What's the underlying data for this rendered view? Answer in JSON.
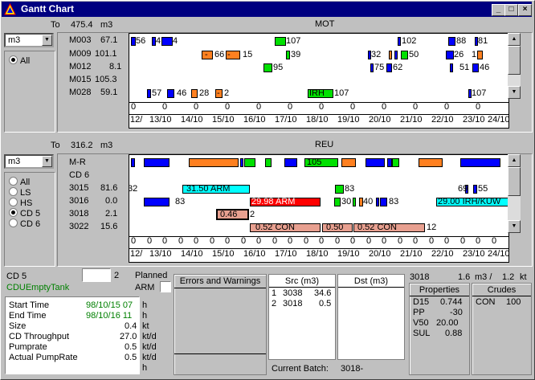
{
  "window": {
    "title": "Gantt Chart",
    "min": "_",
    "max": "□",
    "close": "×"
  },
  "mot": {
    "label_to": "To",
    "total": "475.4",
    "unit_label": "m3",
    "section_title": "MOT",
    "unit_select": "m3",
    "filter_all": "All",
    "rows": [
      {
        "name": "M003",
        "val": "67.1"
      },
      {
        "name": "M009",
        "val": "101.1"
      },
      {
        "name": "M012",
        "val": "8.1"
      },
      {
        "name": "M015",
        "val": "105.3"
      },
      {
        "name": "M028",
        "val": "59.1"
      }
    ],
    "bar_labels": [
      "56",
      "4",
      "4",
      "107",
      "102",
      "88",
      "81",
      "-",
      "66",
      "-",
      "15",
      "39",
      "32",
      "50",
      "26",
      "1",
      "95",
      "75",
      "62",
      "51",
      "46",
      "57",
      "46",
      "28",
      "-",
      "2",
      "IRH",
      "107"
    ],
    "axis_zero": "0",
    "dates": [
      "12/",
      "13/10",
      "14/10",
      "15/10",
      "16/10",
      "17/10",
      "18/10",
      "19/10",
      "20/10",
      "21/10",
      "22/10",
      "23/10",
      "24/10"
    ]
  },
  "reu": {
    "label_to": "To",
    "total": "316.2",
    "unit_label": "m3",
    "section_title": "REU",
    "unit_select": "m3",
    "filters": [
      "All",
      "LS",
      "HS",
      "CD 5",
      "CD 6"
    ],
    "rows": [
      {
        "name": "M-R",
        "val": ""
      },
      {
        "name": "CD 6",
        "val": ""
      },
      {
        "name": "3015",
        "val": "81.6"
      },
      {
        "name": "3016",
        "val": "0.0"
      },
      {
        "name": "3018",
        "val": "2.1"
      },
      {
        "name": "3022",
        "val": "15.6"
      }
    ],
    "bar_labels": [
      "105",
      "32",
      "31.50 ARM",
      "83",
      "69",
      "55",
      "83",
      "29.98 ARM",
      "30",
      "40",
      "83",
      "29.00 IRH/KUW",
      "0.46",
      "2",
      "0.52 CON",
      "0.50",
      "0.52 CON",
      "12"
    ],
    "dates": [
      "12/",
      "13/10",
      "14/10",
      "15/10",
      "16/10",
      "17/10",
      "18/10",
      "19/10",
      "20/10",
      "21/10",
      "22/10",
      "23/10",
      "24/10"
    ]
  },
  "bottom": {
    "cd_label": "CD 5",
    "cd_value": "2",
    "cd_status": "CDUEmptyTank",
    "planned_label": "Planned",
    "arm_label": "ARM",
    "fields": [
      {
        "label": "Start Time",
        "value": "98/10/15 07",
        "unit": "h"
      },
      {
        "label": "End Time",
        "value": "98/10/16 11",
        "unit": "h"
      },
      {
        "label": "Size",
        "value": "0.4",
        "unit": "kt"
      },
      {
        "label": "CD Throughput",
        "value": "27.0",
        "unit": "kt/d"
      },
      {
        "label": "Pumprate",
        "value": "0.5",
        "unit": "kt/d"
      },
      {
        "label": "Actual PumpRate",
        "value": "0.5",
        "unit": "kt/d"
      }
    ],
    "extra_unit": "h",
    "errors_title": "Errors and Warnings",
    "src_title": "Src (m3)",
    "src_rows": [
      {
        "idx": "1",
        "name": "3038",
        "val": "34.6"
      },
      {
        "idx": "2",
        "name": "3018",
        "val": "0.5"
      }
    ],
    "dst_title": "Dst (m3)",
    "current_batch_label": "Current Batch:",
    "current_batch_value": "3018-",
    "tank": "3018",
    "tank_m3": "1.6",
    "tank_m3_unit": "m3 /",
    "tank_kt": "1.2",
    "tank_kt_unit": "kt",
    "properties_title": "Properties",
    "properties": [
      {
        "k": "D15",
        "v": "0.744"
      },
      {
        "k": "PP",
        "v": "-30"
      },
      {
        "k": "V50",
        "v": "20.00"
      },
      {
        "k": "SUL",
        "v": "0.88"
      }
    ],
    "crudes_title": "Crudes",
    "crudes": [
      {
        "k": "CON",
        "v": "100"
      }
    ]
  }
}
